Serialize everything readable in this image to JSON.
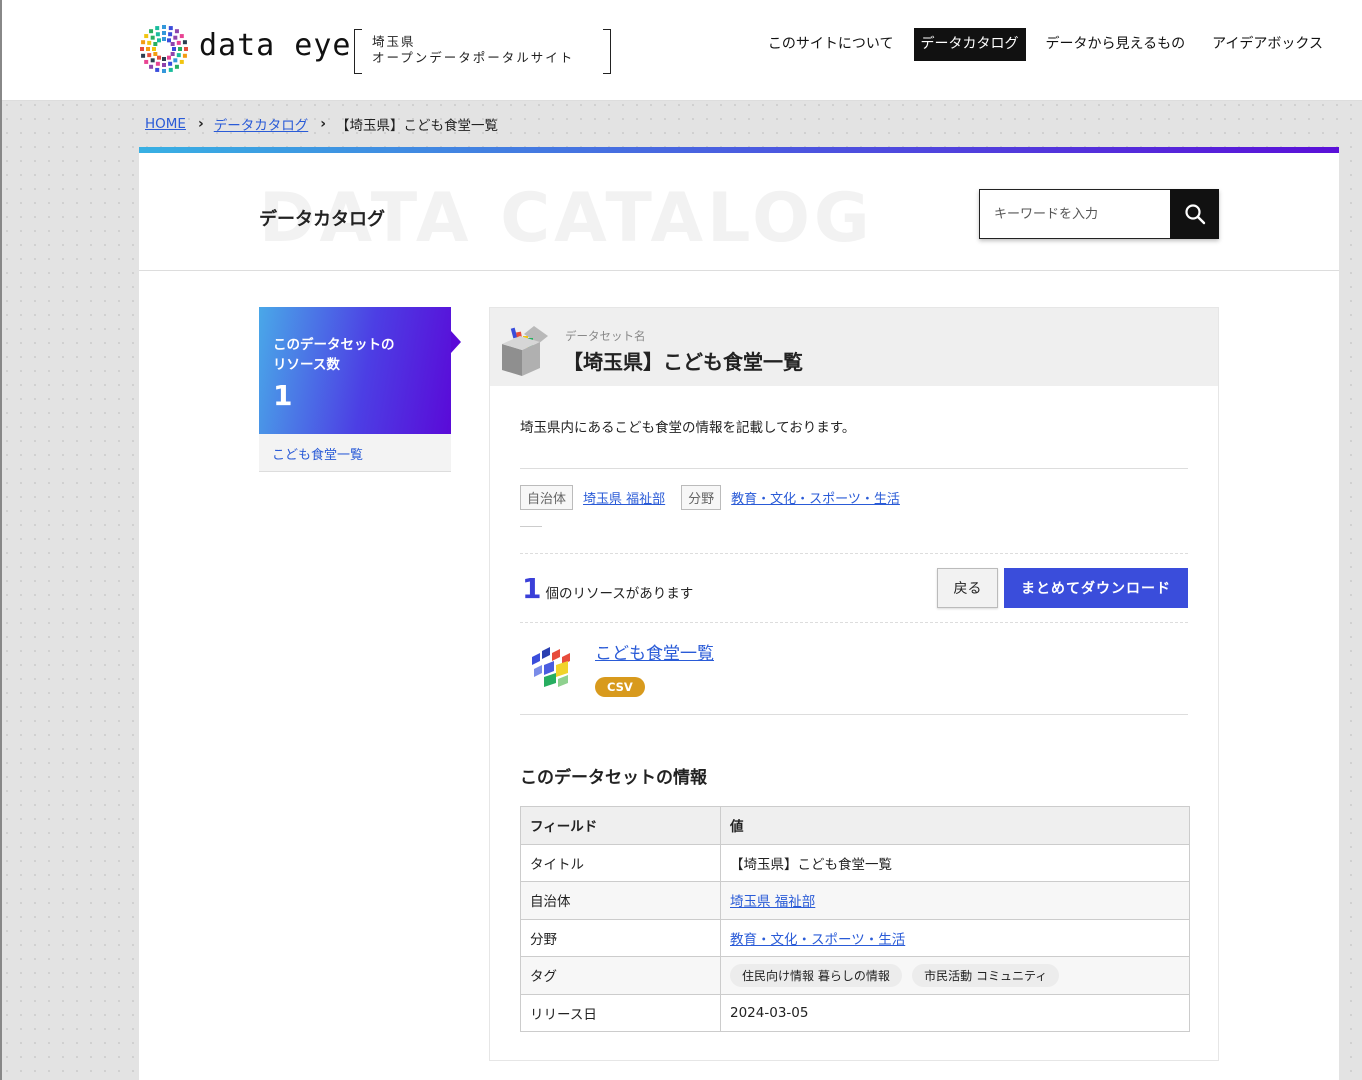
{
  "header": {
    "logo_text": "data eye",
    "site_sub_line1": "埼玉県",
    "site_sub_line2": "オープンデータポータルサイト",
    "nav": [
      "このサイトについて",
      "データカタログ",
      "データから見えるもの",
      "アイデアボックス"
    ],
    "active_nav": "データカタログ"
  },
  "breadcrumb": {
    "home": "HOME",
    "catalog": "データカタログ",
    "current": "【埼玉県】こども食堂一覧"
  },
  "page": {
    "bg_word": "DATA CATALOG",
    "title": "データカタログ",
    "search_placeholder": "キーワードを入力"
  },
  "sidebar": {
    "resources_label_line1": "このデータセットの",
    "resources_label_line2": "リソース数",
    "resources_count": "1",
    "resource_link": "こども食堂一覧"
  },
  "dataset": {
    "sub_label": "データセット名",
    "title": "【埼玉県】こども食堂一覧",
    "description": "埼玉県内にあるこども食堂の情報を記載しております。",
    "org_label": "自治体",
    "org_value": "埼玉県 福祉部",
    "category_label": "分野",
    "category_value": "教育・文化・スポーツ・生活",
    "resource_count": "1",
    "resource_count_text": "個のリソースがあります",
    "back_button": "戻る",
    "download_button": "まとめてダウンロード",
    "resource_name": "こども食堂一覧",
    "resource_format": "CSV",
    "info_title": "このデータセットの情報",
    "table_headers": [
      "フィールド",
      "値"
    ],
    "rows": {
      "title_key": "タイトル",
      "title_value": "【埼玉県】こども食堂一覧",
      "org_key": "自治体",
      "org_value": "埼玉県 福祉部",
      "category_key": "分野",
      "category_value": "教育・文化・スポーツ・生活",
      "tags_key": "タグ",
      "tags": [
        "住民向け情報 暮らしの情報",
        "市民活動 コミュニティ"
      ],
      "release_key": "リリース日",
      "release_value": "2024-03-05"
    }
  },
  "colors": {
    "accent_blue": "#3a4ddb",
    "link": "#2a5bd7",
    "csv_badge": "#d89a1d"
  }
}
